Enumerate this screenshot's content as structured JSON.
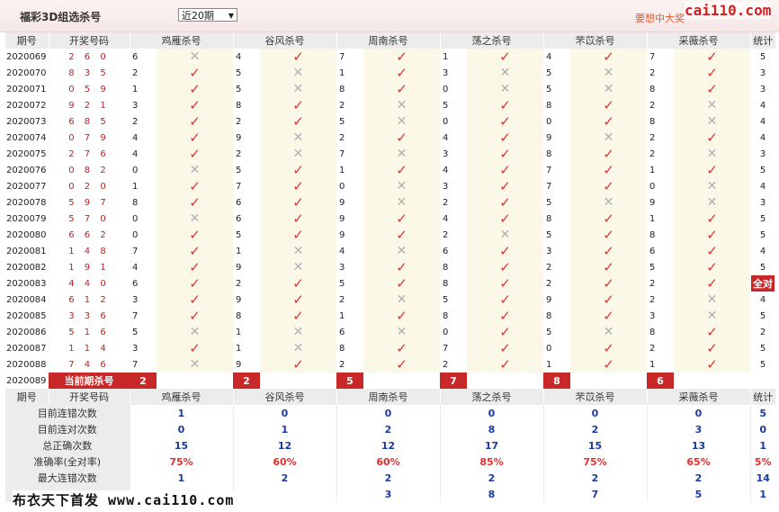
{
  "header": {
    "title": "福彩3D组选杀号",
    "period_select": "近20期",
    "promo_text": "要想中大奖",
    "brand": "cai110.com"
  },
  "columns": {
    "issue": "期号",
    "draw": "开奖号码",
    "killers": [
      "鸡雁杀号",
      "谷风杀号",
      "周南杀号",
      "荡之杀号",
      "芣苡杀号",
      "采薇杀号"
    ],
    "stat": "统计"
  },
  "rows": [
    {
      "issue": "2020069",
      "draw": "2 6 0",
      "kills": [
        [
          "6",
          0
        ],
        [
          "4",
          1
        ],
        [
          "7",
          1
        ],
        [
          "1",
          1
        ],
        [
          "4",
          1
        ],
        [
          "7",
          1
        ]
      ],
      "stat": "5"
    },
    {
      "issue": "2020070",
      "draw": "8 3 5",
      "kills": [
        [
          "2",
          1
        ],
        [
          "5",
          0
        ],
        [
          "1",
          1
        ],
        [
          "3",
          0
        ],
        [
          "5",
          0
        ],
        [
          "2",
          1
        ]
      ],
      "stat": "3"
    },
    {
      "issue": "2020071",
      "draw": "0 5 9",
      "kills": [
        [
          "1",
          1
        ],
        [
          "5",
          0
        ],
        [
          "8",
          1
        ],
        [
          "0",
          0
        ],
        [
          "5",
          0
        ],
        [
          "8",
          1
        ]
      ],
      "stat": "3"
    },
    {
      "issue": "2020072",
      "draw": "9 2 1",
      "kills": [
        [
          "3",
          1
        ],
        [
          "8",
          1
        ],
        [
          "2",
          0
        ],
        [
          "5",
          1
        ],
        [
          "8",
          1
        ],
        [
          "2",
          0
        ]
      ],
      "stat": "4"
    },
    {
      "issue": "2020073",
      "draw": "6 8 5",
      "kills": [
        [
          "2",
          1
        ],
        [
          "2",
          1
        ],
        [
          "5",
          0
        ],
        [
          "0",
          1
        ],
        [
          "0",
          1
        ],
        [
          "8",
          0
        ]
      ],
      "stat": "4"
    },
    {
      "issue": "2020074",
      "draw": "0 7 9",
      "kills": [
        [
          "4",
          1
        ],
        [
          "9",
          0
        ],
        [
          "2",
          1
        ],
        [
          "4",
          1
        ],
        [
          "9",
          0
        ],
        [
          "2",
          1
        ]
      ],
      "stat": "4"
    },
    {
      "issue": "2020075",
      "draw": "2 7 6",
      "kills": [
        [
          "4",
          1
        ],
        [
          "2",
          0
        ],
        [
          "7",
          0
        ],
        [
          "3",
          1
        ],
        [
          "8",
          1
        ],
        [
          "2",
          0
        ]
      ],
      "stat": "3"
    },
    {
      "issue": "2020076",
      "draw": "0 8 2",
      "kills": [
        [
          "0",
          0
        ],
        [
          "5",
          1
        ],
        [
          "1",
          1
        ],
        [
          "4",
          1
        ],
        [
          "7",
          1
        ],
        [
          "1",
          1
        ]
      ],
      "stat": "5"
    },
    {
      "issue": "2020077",
      "draw": "0 2 0",
      "kills": [
        [
          "1",
          1
        ],
        [
          "7",
          1
        ],
        [
          "0",
          0
        ],
        [
          "3",
          1
        ],
        [
          "7",
          1
        ],
        [
          "0",
          0
        ]
      ],
      "stat": "4"
    },
    {
      "issue": "2020078",
      "draw": "5 9 7",
      "kills": [
        [
          "8",
          1
        ],
        [
          "6",
          1
        ],
        [
          "9",
          0
        ],
        [
          "2",
          1
        ],
        [
          "5",
          0
        ],
        [
          "9",
          0
        ]
      ],
      "stat": "3"
    },
    {
      "issue": "2020079",
      "draw": "5 7 0",
      "kills": [
        [
          "0",
          0
        ],
        [
          "6",
          1
        ],
        [
          "9",
          1
        ],
        [
          "4",
          1
        ],
        [
          "8",
          1
        ],
        [
          "1",
          1
        ]
      ],
      "stat": "5"
    },
    {
      "issue": "2020080",
      "draw": "6 6 2",
      "kills": [
        [
          "0",
          1
        ],
        [
          "5",
          1
        ],
        [
          "9",
          1
        ],
        [
          "2",
          0
        ],
        [
          "5",
          1
        ],
        [
          "8",
          1
        ]
      ],
      "stat": "5"
    },
    {
      "issue": "2020081",
      "draw": "1 4 8",
      "kills": [
        [
          "7",
          1
        ],
        [
          "1",
          0
        ],
        [
          "4",
          0
        ],
        [
          "6",
          1
        ],
        [
          "3",
          1
        ],
        [
          "6",
          1
        ]
      ],
      "stat": "4"
    },
    {
      "issue": "2020082",
      "draw": "1 9 1",
      "kills": [
        [
          "4",
          1
        ],
        [
          "9",
          0
        ],
        [
          "3",
          1
        ],
        [
          "8",
          1
        ],
        [
          "2",
          1
        ],
        [
          "5",
          1
        ]
      ],
      "stat": "5"
    },
    {
      "issue": "2020083",
      "draw": "4 4 0",
      "kills": [
        [
          "6",
          1
        ],
        [
          "2",
          1
        ],
        [
          "5",
          1
        ],
        [
          "8",
          1
        ],
        [
          "2",
          1
        ],
        [
          "2",
          1
        ]
      ],
      "stat": "quan"
    },
    {
      "issue": "2020084",
      "draw": "6 1 2",
      "kills": [
        [
          "3",
          1
        ],
        [
          "9",
          1
        ],
        [
          "2",
          0
        ],
        [
          "5",
          1
        ],
        [
          "9",
          1
        ],
        [
          "2",
          0
        ]
      ],
      "stat": "4"
    },
    {
      "issue": "2020085",
      "draw": "3 3 6",
      "kills": [
        [
          "7",
          1
        ],
        [
          "8",
          1
        ],
        [
          "1",
          1
        ],
        [
          "8",
          1
        ],
        [
          "8",
          1
        ],
        [
          "3",
          0
        ]
      ],
      "stat": "5"
    },
    {
      "issue": "2020086",
      "draw": "5 1 6",
      "kills": [
        [
          "5",
          0
        ],
        [
          "1",
          0
        ],
        [
          "6",
          0
        ],
        [
          "0",
          1
        ],
        [
          "5",
          0
        ],
        [
          "8",
          1
        ]
      ],
      "stat": "2"
    },
    {
      "issue": "2020087",
      "draw": "1 1 4",
      "kills": [
        [
          "3",
          1
        ],
        [
          "1",
          0
        ],
        [
          "8",
          1
        ],
        [
          "7",
          1
        ],
        [
          "0",
          1
        ],
        [
          "2",
          1
        ]
      ],
      "stat": "5"
    },
    {
      "issue": "2020088",
      "draw": "7 4 6",
      "kills": [
        [
          "7",
          0
        ],
        [
          "9",
          1
        ],
        [
          "2",
          1
        ],
        [
          "2",
          1
        ],
        [
          "1",
          1
        ],
        [
          "1",
          1
        ]
      ],
      "stat": "5"
    }
  ],
  "quan_label": "全对",
  "current": {
    "issue": "2020089",
    "label": "当前期杀号",
    "picks": [
      "2",
      "2",
      "5",
      "7",
      "8",
      "6"
    ]
  },
  "stats": {
    "header_issue": "期号",
    "header_draw": "开奖号码",
    "rows": [
      {
        "label": "目前连错次数",
        "values": [
          "1",
          "0",
          "0",
          "0",
          "0",
          "0"
        ],
        "stat": "5"
      },
      {
        "label": "目前连对次数",
        "values": [
          "0",
          "1",
          "2",
          "8",
          "2",
          "3"
        ],
        "stat": "0"
      },
      {
        "label": "总正确次数",
        "values": [
          "15",
          "12",
          "12",
          "17",
          "15",
          "13"
        ],
        "stat": "1"
      },
      {
        "label": "准确率(全对率)",
        "values": [
          "75%",
          "60%",
          "60%",
          "85%",
          "75%",
          "65%"
        ],
        "stat": "5%"
      },
      {
        "label": "最大连错次数",
        "values": [
          "1",
          "2",
          "2",
          "2",
          "2",
          "2"
        ],
        "stat": "14"
      },
      {
        "label": "",
        "values": [
          "",
          "",
          "3",
          "8",
          "7",
          "5"
        ],
        "stat": "1"
      }
    ]
  },
  "marks": {
    "ok": "✓",
    "no": "✕"
  },
  "watermark": "布衣天下首发 www.cai110.com"
}
